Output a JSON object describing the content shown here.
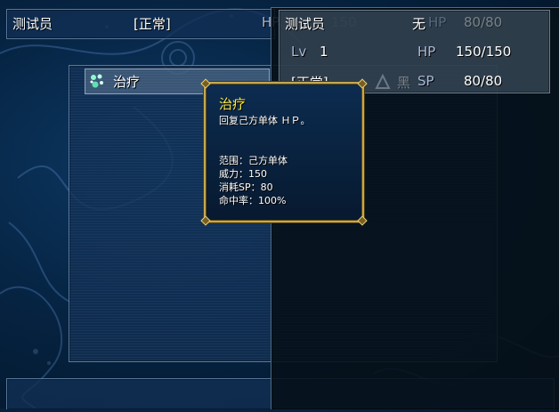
{
  "top_bar": {
    "actor_name": "测试员",
    "state": "[正常]",
    "hp_label": "HP",
    "hp_value": "150"
  },
  "status_window": {
    "name": "测试员",
    "class_name": "无",
    "level_label": "Lv",
    "level_value": "1",
    "hp_label": "HP",
    "hp_value": "150/150",
    "sp_label": "SP",
    "sp_value": "80/80",
    "state": "[正常]",
    "faded_hp_label": "HP",
    "faded_sp_value": "80/80",
    "faded_label": "黑"
  },
  "skill_list": {
    "items": [
      {
        "name": "治疗",
        "icon": "sparkle-heal-icon"
      }
    ]
  },
  "tooltip": {
    "title": "治疗",
    "description": "回复己方单体 ＨＰ。",
    "lines": [
      "范围：己方单体",
      "威力：150",
      "消耗SP：80",
      "命中率：100%"
    ]
  },
  "colors": {
    "title_yellow": "#ffee44",
    "tooltip_border": "#c9a84a",
    "system_blue": "#a8b8d8"
  }
}
